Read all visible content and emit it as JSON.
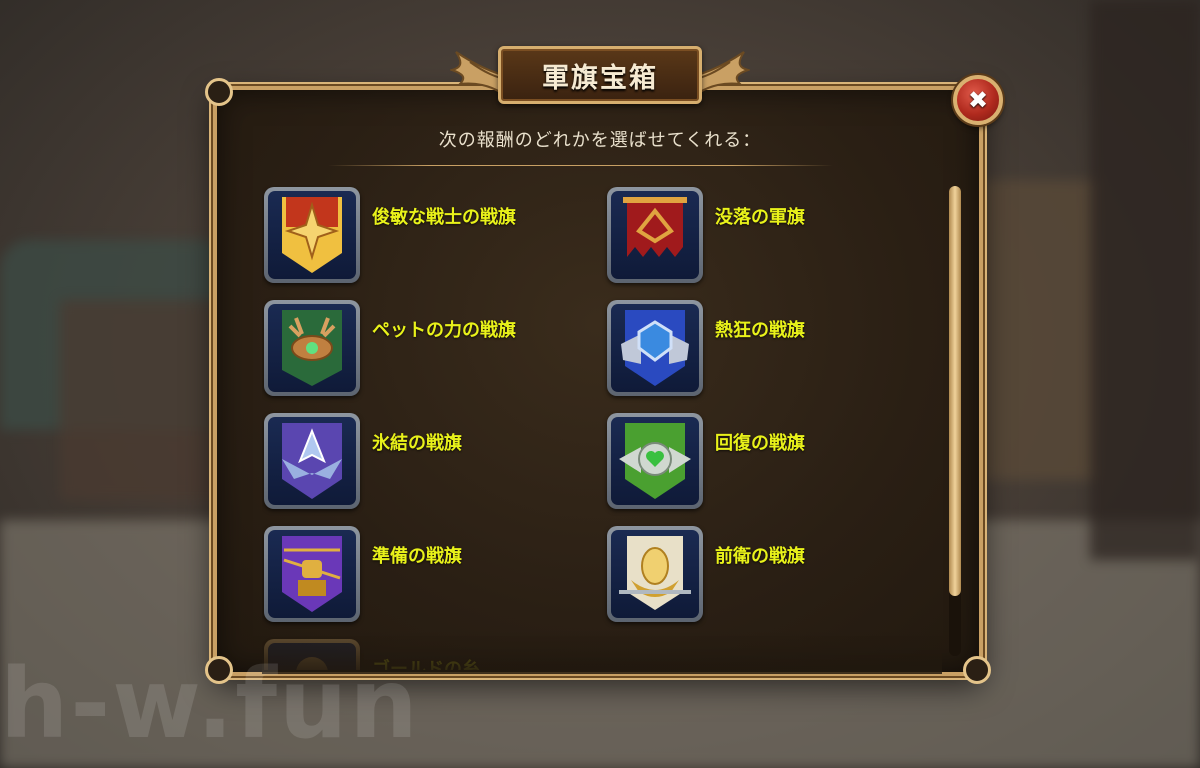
{
  "dialog": {
    "title": "軍旗宝箱",
    "subtitle": "次の報酬のどれかを選ばせてくれる：",
    "close_icon": "close-icon"
  },
  "banners": [
    {
      "label": "俊敏な戦士の戦旗",
      "icon": "agile-warrior-banner-icon",
      "colors": [
        "#c2361c",
        "#f0c040"
      ]
    },
    {
      "label": "没落の軍旗",
      "icon": "fallen-banner-icon",
      "colors": [
        "#a01a1c",
        "#e0a440"
      ]
    },
    {
      "label": "ペットの力の戦旗",
      "icon": "pet-power-banner-icon",
      "colors": [
        "#2a6a3a",
        "#d8a060"
      ]
    },
    {
      "label": "熱狂の戦旗",
      "icon": "frenzy-banner-icon",
      "colors": [
        "#2a4ac0",
        "#c0c8d8"
      ]
    },
    {
      "label": "氷結の戦旗",
      "icon": "freeze-banner-icon",
      "colors": [
        "#5a46b0",
        "#b0c8f0"
      ]
    },
    {
      "label": "回復の戦旗",
      "icon": "healing-banner-icon",
      "colors": [
        "#4aa030",
        "#d0d8d0"
      ]
    },
    {
      "label": "準備の戦旗",
      "icon": "preparation-banner-icon",
      "colors": [
        "#6a38b8",
        "#e0b040"
      ]
    },
    {
      "label": "前衛の戦旗",
      "icon": "vanguard-banner-icon",
      "colors": [
        "#2a3a90",
        "#f0d070"
      ]
    },
    {
      "label": "ゴールドの糸",
      "icon": "gold-thread-icon",
      "colors": [
        "#2a3a70",
        "#c8a060"
      ]
    }
  ],
  "watermark": "h-w.fun"
}
